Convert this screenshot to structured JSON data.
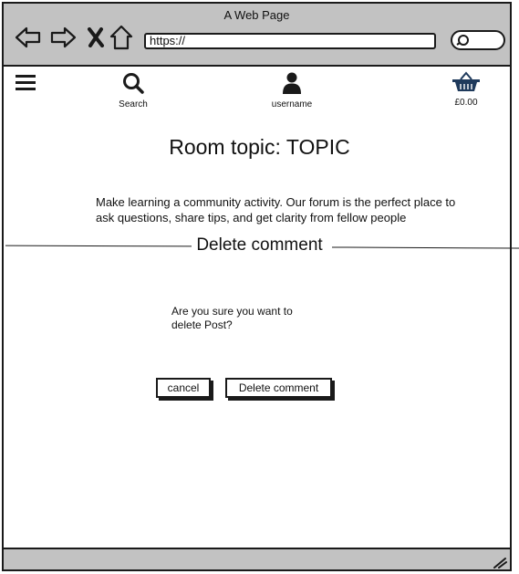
{
  "window": {
    "title": "A Web Page"
  },
  "address_bar": {
    "url": "https://"
  },
  "icon_bar": {
    "search_label": "Search",
    "user_label": "username",
    "cart_label": "£0.00"
  },
  "page": {
    "topic": "Room topic: TOPIC",
    "description": "Make learning a community activity. Our forum is the perfect place to ask questions, share tips, and get clarity from fellow people",
    "section_title": "Delete comment",
    "confirm_text": "Are you sure you want to delete Post?",
    "cancel_label": "cancel",
    "delete_label": "Delete comment"
  },
  "colors": {
    "chrome": "#c2c2c2",
    "ink": "#1a1a1a",
    "cart": "#1f3a5c"
  }
}
